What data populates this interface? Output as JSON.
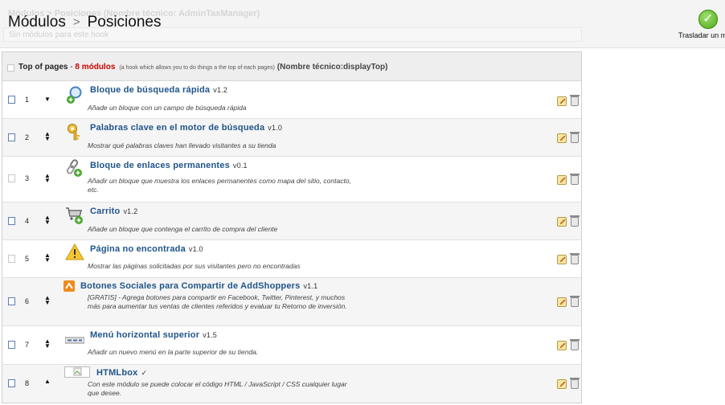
{
  "header": {
    "ghost_title": "Módulos > Posiciones (Nombre técnico: AdminTaxManager)",
    "ghost_subtitle": "Sin módulos para este hook",
    "breadcrumb_root": "Módulos",
    "breadcrumb_separator": ">",
    "breadcrumb_current": "Posiciones",
    "translate_label": "Trasladar un mó",
    "translate_icon": "check-icon"
  },
  "hook": {
    "name": "Top of pages",
    "separator": " - ",
    "count": "8 módulos",
    "description": "(a hook which allows you to do things a the top of each pages)",
    "technical_name": "(Nombre técnico:displayTop)"
  },
  "modules": [
    {
      "position": "1",
      "name": "Bloque de búsqueda rápida",
      "version": "v1.2",
      "description": "Añade un bloque con un campo de búsqueda rápida",
      "icon": "search-add-icon"
    },
    {
      "position": "2",
      "name": "Palabras clave en el motor de búsqueda",
      "version": "v1.0",
      "description": "Mostrar qué palabras claves han llevado visitantes a su tienda",
      "icon": "keys-icon"
    },
    {
      "position": "3",
      "name": "Bloque de enlaces permanentes",
      "version": "v0.1",
      "description": "Añadir un bloque que muestra los enlaces permanentes como mapa del sitio, contacto, etc.",
      "icon": "link-add-icon"
    },
    {
      "position": "4",
      "name": "Carrito",
      "version": "v1.2",
      "description": "Añade un bloque que contenga el carrito de compra del cliente",
      "icon": "cart-add-icon"
    },
    {
      "position": "5",
      "name": "Página no encontrada",
      "version": "v1.0",
      "description": "Mostrar las páginas solicitadas por sus visitantes pero no encontradas",
      "icon": "warning-icon"
    },
    {
      "position": "6",
      "name": "Botones Sociales para Compartir de AddShoppers",
      "version": "v1.1",
      "description": "[GRATIS] - Agrega botones para compartir en Facebook, Twitter, Pinterest, y muchos más para aumentar tus ventas de clientes referidos y evaluar tu Retorno de inversión.",
      "icon": "addshoppers-logo-icon"
    },
    {
      "position": "7",
      "name": "Menú horizontal superior",
      "version": "v1.5",
      "description": "Añadir un nuevo menú en la parte superior de su tienda.",
      "icon": "menu-bar-icon"
    },
    {
      "position": "8",
      "name": "HTMLbox",
      "version": "✓",
      "description": "Con este módulo se puede colocar el código HTML / JavaScript / CSS cualquier lugar que desee.",
      "icon": "broken-image-icon"
    }
  ],
  "colors": {
    "link": "#20558a",
    "count": "#cc0000",
    "accent_green": "#4fa51b"
  }
}
